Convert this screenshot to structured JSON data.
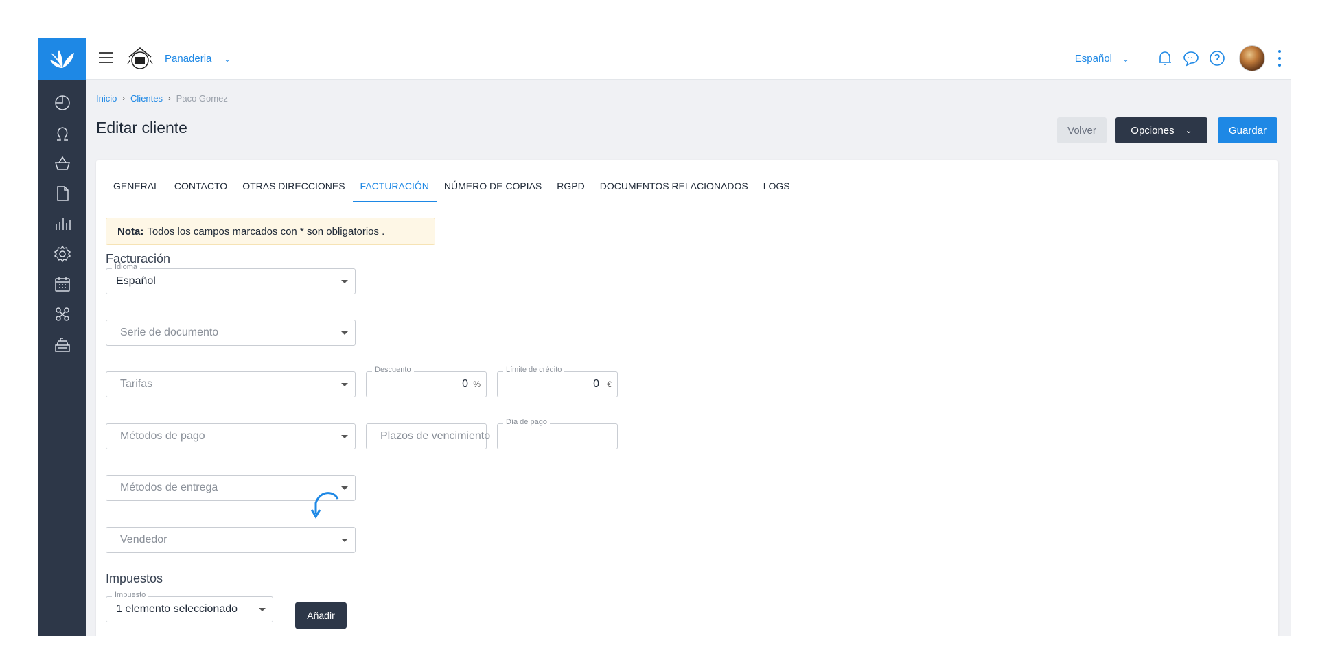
{
  "topbar": {
    "company_name": "Panaderia",
    "language": "Español"
  },
  "breadcrumb": {
    "inicio": "Inicio",
    "clientes": "Clientes",
    "current": "Paco Gomez"
  },
  "page": {
    "title": "Editar cliente"
  },
  "actions": {
    "volver": "Volver",
    "opciones": "Opciones",
    "guardar": "Guardar"
  },
  "tabs": [
    {
      "label": "GENERAL"
    },
    {
      "label": "CONTACTO"
    },
    {
      "label": "OTRAS DIRECCIONES"
    },
    {
      "label": "FACTURACIÓN"
    },
    {
      "label": "NÚMERO DE COPIAS"
    },
    {
      "label": "RGPD"
    },
    {
      "label": "DOCUMENTOS RELACIONADOS"
    },
    {
      "label": "LOGS"
    }
  ],
  "active_tab": "FACTURACIÓN",
  "note": {
    "label": "Nota:",
    "text": "Todos los campos marcados con * son obligatorios ."
  },
  "facturacion": {
    "section_title": "Facturación",
    "idioma_label": "Idioma",
    "idioma_value": "Español",
    "serie_placeholder": "Serie de documento",
    "tarifas_placeholder": "Tarifas",
    "descuento_label": "Descuento",
    "descuento_value": "0",
    "descuento_unit": "%",
    "limite_label": "Límite de crédito",
    "limite_value": "0",
    "limite_unit": "€",
    "metodos_pago_placeholder": "Métodos de pago",
    "plazos_placeholder": "Plazos de vencimiento",
    "dia_pago_label": "Día de pago",
    "metodos_entrega_placeholder": "Métodos de entrega",
    "vendedor_placeholder": "Vendedor"
  },
  "impuestos": {
    "section_title": "Impuestos",
    "impuesto_label": "Impuesto",
    "impuesto_value": "1 elemento seleccionado",
    "add_button": "Añadir"
  },
  "colors": {
    "accent": "#1e88e5",
    "sidebar": "#2d3748",
    "note_bg": "#fef7e6"
  }
}
